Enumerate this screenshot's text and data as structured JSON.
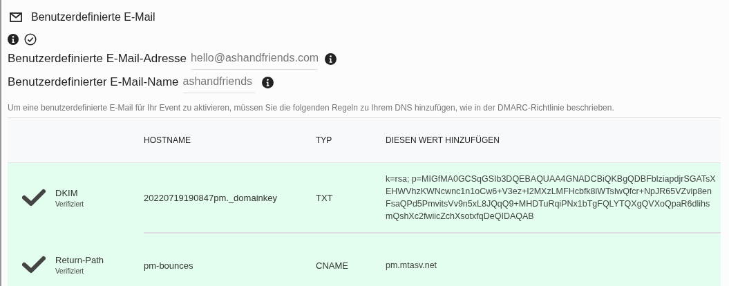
{
  "section": {
    "title": "Benutzerdefinierte E-Mail",
    "verified": true
  },
  "fields": [
    {
      "label": "Benutzerdefinierte E-Mail-Adresse",
      "value": "hello@ashandfriends.com"
    },
    {
      "label": "Benutzerdefinierter E-Mail-Name",
      "value": "ashandfriends"
    }
  ],
  "description": "Um eine benutzerdefinierte E-Mail für Ihr Event zu aktivieren, müssen Sie die folgenden Regeln zu Ihrem DNS hinzufügen, wie in der DMARC-Richtlinie beschrieben.",
  "table": {
    "columns": [
      "HOSTNAME",
      "TYP",
      "DIESEN WERT HINZUFÜGEN"
    ],
    "rows": [
      {
        "name": "DKIM",
        "status": "Verifiziert",
        "verified": true,
        "hostname": "20220719190847pm._domainkey",
        "type": "TXT",
        "value": "k=rsa; p=MIGfMA0GCSqGSIb3DQEBAQUAA4GNADCBiQKBgQDBFblziapdjrSGATsXEHWVhzKWNcwnc1n1oCw6+V3ez+I2MXzLMFHcbfk8iWTsIwQfcr+NpJR65VZvip8enFsaQPd5PmvitsVv9n5xL8JQqQ9+MHDTuRqiPNx1bTgFQLYTQXgQVXoQpaR6dlihsmQshXc2fwiicZchXsotxfqDeQIDAQAB"
      },
      {
        "name": "Return-Path",
        "status": "Verifiziert",
        "verified": true,
        "hostname": "pm-bounces",
        "type": "CNAME",
        "value": "pm.mtasv.net"
      }
    ]
  }
}
